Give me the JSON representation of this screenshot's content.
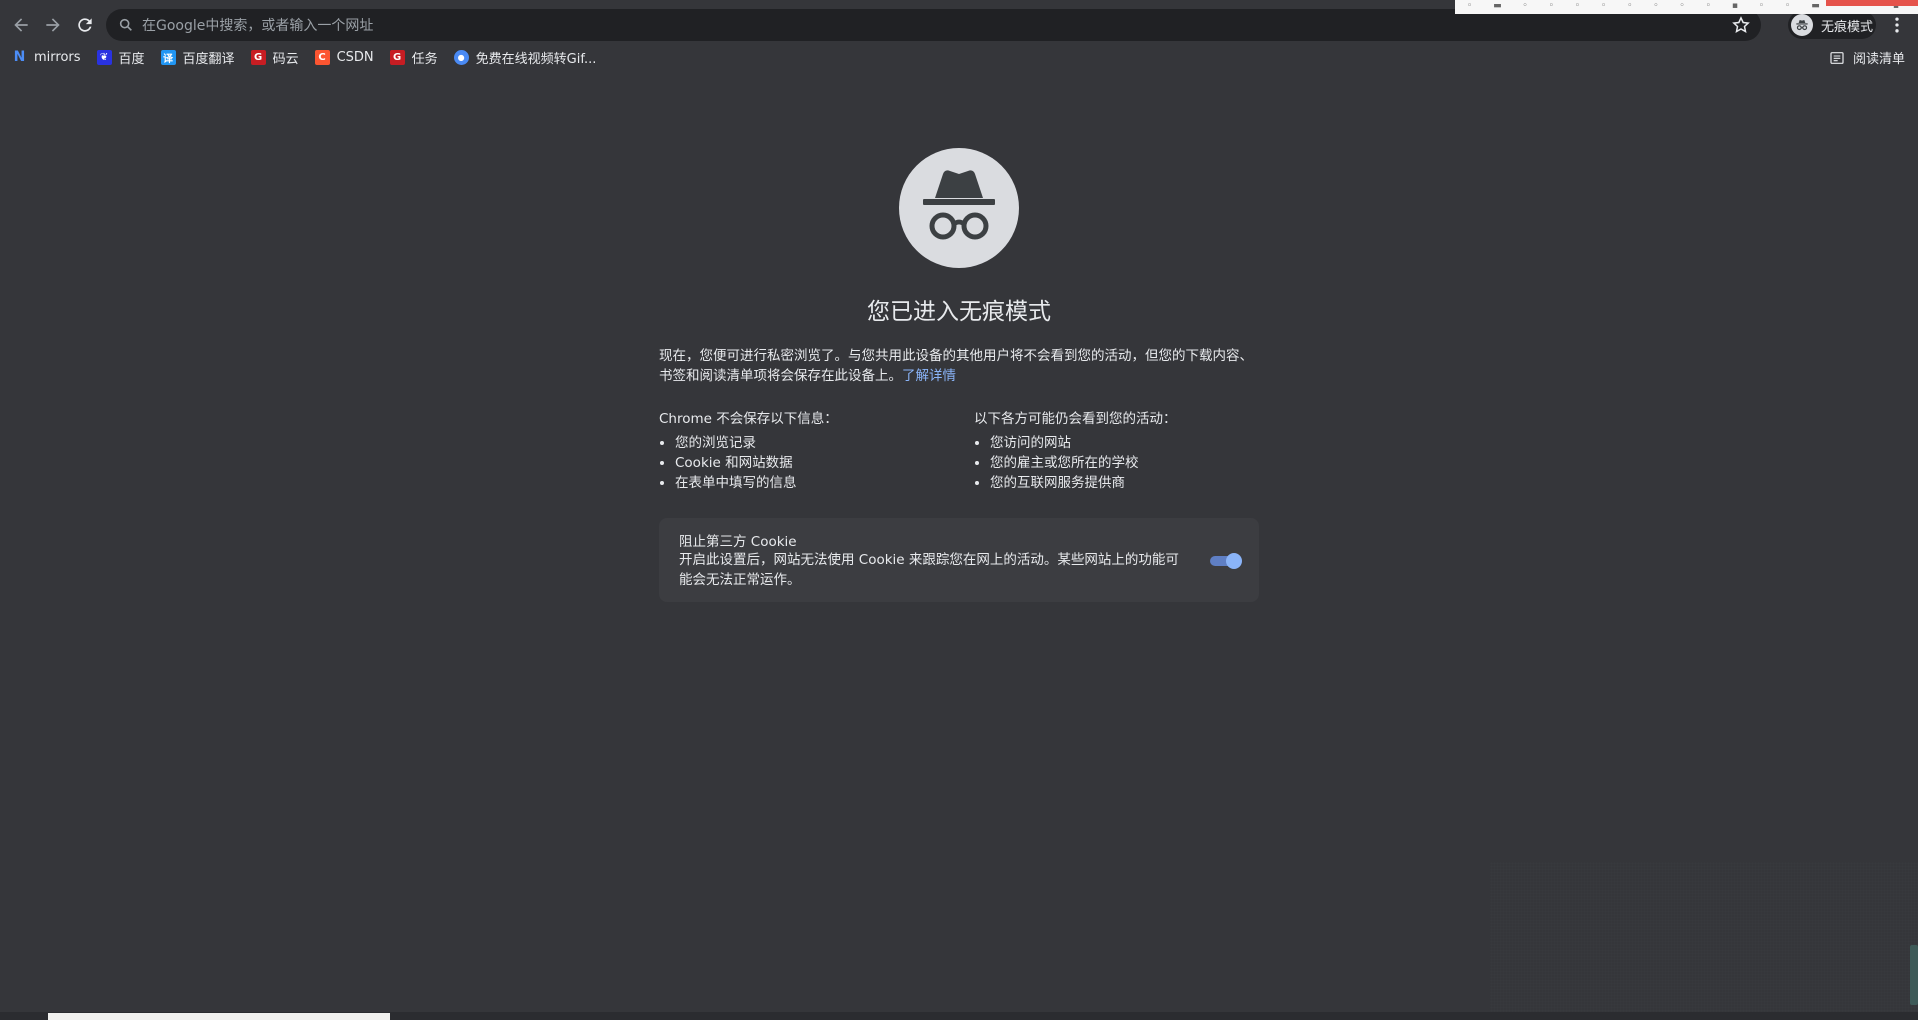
{
  "toolbar": {
    "omnibox_placeholder": "在Google中搜索，或者输入一个网址",
    "incognito_label": "无痕模式"
  },
  "bookmarks": [
    {
      "label": "mirrors",
      "icon": "N",
      "color": "#1a73e8"
    },
    {
      "label": "百度",
      "icon": "❦",
      "color": "#2932e1"
    },
    {
      "label": "百度翻译",
      "icon": "译",
      "color": "#2196f3"
    },
    {
      "label": "码云",
      "icon": "G",
      "color": "#c71d23"
    },
    {
      "label": "CSDN",
      "icon": "C",
      "color": "#fc5531"
    },
    {
      "label": "任务",
      "icon": "G",
      "color": "#c71d23"
    },
    {
      "label": "免费在线视频转Gif...",
      "icon": "●",
      "color": "#4a8af4"
    }
  ],
  "reading_list_label": "阅读清单",
  "incognito_page": {
    "title": "您已进入无痕模式",
    "intro": "现在，您便可进行私密浏览了。与您共用此设备的其他用户将不会看到您的活动，但您的下载内容、书签和阅读清单项将会保存在此设备上。",
    "learn_more": "了解详情",
    "not_saved": {
      "heading": "Chrome 不会保存以下信息：",
      "items": [
        "您的浏览记录",
        "Cookie 和网站数据",
        "在表单中填写的信息"
      ]
    },
    "may_see": {
      "heading": "以下各方可能仍会看到您的活动：",
      "items": [
        "您访问的网站",
        "您的雇主或您所在的学校",
        "您的互联网服务提供商"
      ]
    },
    "cookie_card": {
      "title": "阻止第三方 Cookie",
      "description": "开启此设置后，网站无法使用 Cookie 来跟踪您在网上的活动。某些网站上的功能可能会无法正常运作。",
      "toggle_on": true
    }
  },
  "colors": {
    "background": "#35363a",
    "omnibox": "#202124",
    "link": "#8ab4f8",
    "toggle": "#8ab4f8"
  },
  "icons": [
    "back-icon",
    "forward-icon",
    "reload-icon",
    "search-icon",
    "star-icon",
    "incognito-icon",
    "more-vert-icon",
    "reading-list-icon"
  ]
}
